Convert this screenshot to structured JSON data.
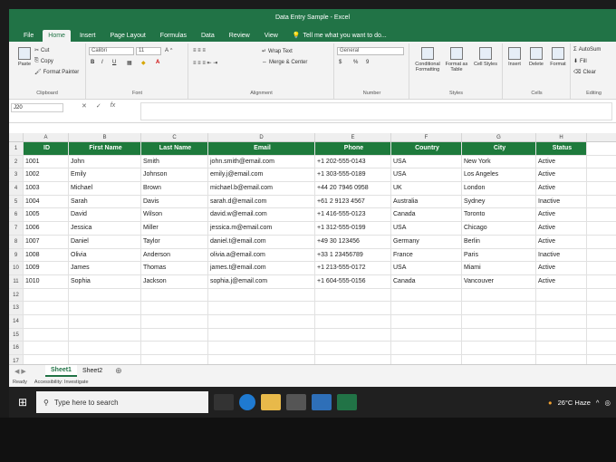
{
  "window": {
    "title": "Data Entry Sample - Excel"
  },
  "tabs": [
    "File",
    "Home",
    "Insert",
    "Page Layout",
    "Formulas",
    "Data",
    "Review",
    "View"
  ],
  "tell_me": "Tell me what you want to do...",
  "ribbon": {
    "clipboard": {
      "paste": "Paste",
      "cut": "Cut",
      "copy": "Copy",
      "format_painter": "Format Painter",
      "label": "Clipboard"
    },
    "font": {
      "name": "Calibri",
      "size": "11",
      "label": "Font",
      "bold": "B",
      "italic": "I",
      "underline": "U"
    },
    "alignment": {
      "wrap": "Wrap Text",
      "merge": "Merge & Center",
      "label": "Alignment"
    },
    "number": {
      "format": "General",
      "currency": "$",
      "percent": "%",
      "comma": "9",
      "label": "Number"
    },
    "styles": {
      "conditional": "Conditional Formatting",
      "table": "Format as Table",
      "cell": "Cell Styles",
      "label": "Styles"
    },
    "cells": {
      "insert": "Insert",
      "delete": "Delete",
      "format": "Format",
      "label": "Cells"
    },
    "editing": {
      "autosum": "AutoSum",
      "fill": "Fill",
      "clear": "Clear",
      "label": "Editing"
    }
  },
  "formula_bar": {
    "name_box": "J20",
    "fx": "fx"
  },
  "columns": [
    "A",
    "B",
    "C",
    "D",
    "E",
    "F",
    "G",
    "H"
  ],
  "headers": [
    "ID",
    "First Name",
    "Last Name",
    "Email",
    "Phone",
    "Country",
    "City",
    "Status"
  ],
  "rows": [
    [
      "1001",
      "John",
      "Smith",
      "john.smith@email.com",
      "+1 202-555-0143",
      "USA",
      "New York",
      "Active"
    ],
    [
      "1002",
      "Emily",
      "Johnson",
      "emily.j@email.com",
      "+1 303-555-0189",
      "USA",
      "Los Angeles",
      "Active"
    ],
    [
      "1003",
      "Michael",
      "Brown",
      "michael.b@email.com",
      "+44 20 7946 0958",
      "UK",
      "London",
      "Active"
    ],
    [
      "1004",
      "Sarah",
      "Davis",
      "sarah.d@email.com",
      "+61 2 9123 4567",
      "Australia",
      "Sydney",
      "Inactive"
    ],
    [
      "1005",
      "David",
      "Wilson",
      "david.w@email.com",
      "+1 416-555-0123",
      "Canada",
      "Toronto",
      "Active"
    ],
    [
      "1006",
      "Jessica",
      "Miller",
      "jessica.m@email.com",
      "+1 312-555-0199",
      "USA",
      "Chicago",
      "Active"
    ],
    [
      "1007",
      "Daniel",
      "Taylor",
      "daniel.t@email.com",
      "+49 30 123456",
      "Germany",
      "Berlin",
      "Active"
    ],
    [
      "1008",
      "Olivia",
      "Anderson",
      "olivia.a@email.com",
      "+33 1 23456789",
      "France",
      "Paris",
      "Inactive"
    ],
    [
      "1009",
      "James",
      "Thomas",
      "james.t@email.com",
      "+1 213-555-0172",
      "USA",
      "Miami",
      "Active"
    ],
    [
      "1010",
      "Sophia",
      "Jackson",
      "sophia.j@email.com",
      "+1 604-555-0156",
      "Canada",
      "Vancouver",
      "Active"
    ]
  ],
  "row_numbers": [
    "1",
    "2",
    "3",
    "4",
    "5",
    "6",
    "7",
    "8",
    "9",
    "10",
    "11",
    "12",
    "13",
    "14",
    "15",
    "16",
    "17"
  ],
  "sheets": [
    "Sheet1",
    "Sheet2"
  ],
  "status": {
    "ready": "Ready",
    "accessibility": "Accessibility: Investigate"
  },
  "taskbar": {
    "search_placeholder": "Type here to search",
    "weather": "26°C Haze"
  },
  "colors": {
    "excel_green": "#217346",
    "header_fill": "#1e7a3c"
  }
}
